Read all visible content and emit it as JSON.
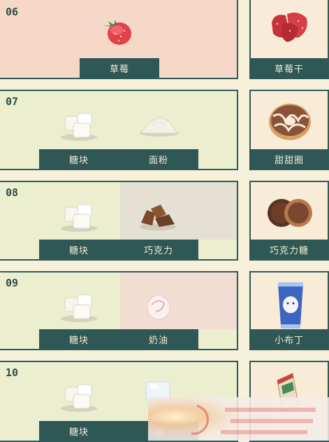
{
  "recipes": [
    {
      "number": "06",
      "ingredients": [
        "草莓"
      ],
      "result": "草莓干"
    },
    {
      "number": "07",
      "ingredients": [
        "糖块",
        "面粉"
      ],
      "result": "甜甜圈"
    },
    {
      "number": "08",
      "ingredients": [
        "糖块",
        "巧克力"
      ],
      "result": "巧克力糖"
    },
    {
      "number": "09",
      "ingredients": [
        "糖块",
        "奶油"
      ],
      "result": "小布丁"
    },
    {
      "number": "10",
      "ingredients": [
        "糖块",
        "冰"
      ],
      "result": ""
    }
  ],
  "colors": {
    "panel_border": "#2f5a57",
    "label_bg": "#2e5756",
    "label_text": "#f4ecd0",
    "pink_bg": "#f5d9c9",
    "green_bg": "#ecefcf"
  }
}
